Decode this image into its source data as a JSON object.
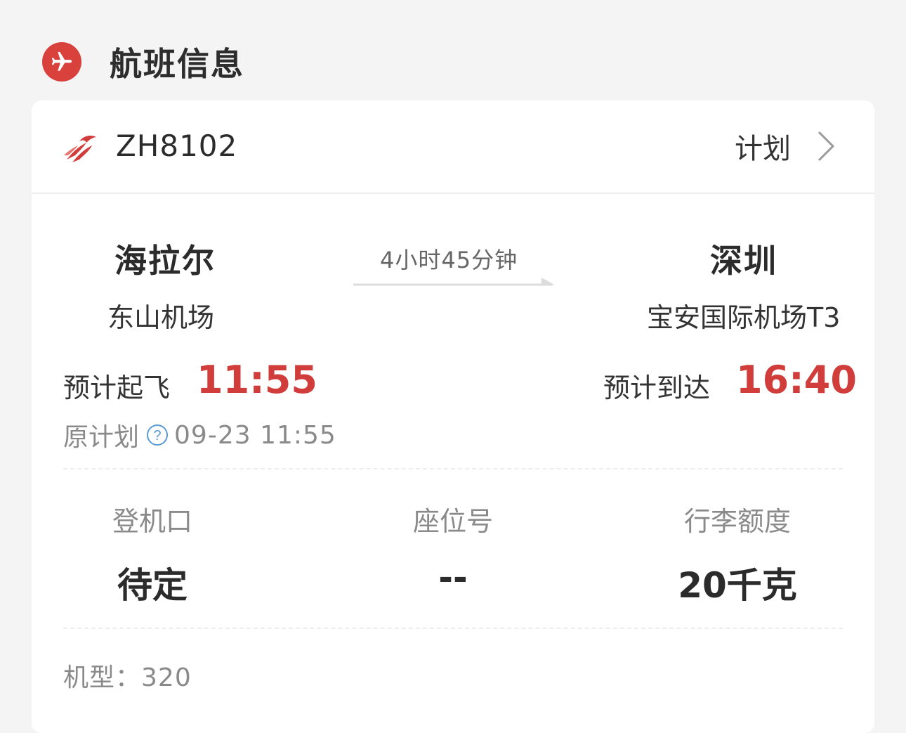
{
  "section": {
    "title": "航班信息",
    "icon": "airplane-icon"
  },
  "flight": {
    "number": "ZH8102",
    "airline_logo": "shenzhen-airlines-logo",
    "plan_label": "计划"
  },
  "route": {
    "origin_city": "海拉尔",
    "origin_airport": "东山机场",
    "destination_city": "深圳",
    "destination_airport": "宝安国际机场T3",
    "duration": "4小时45分钟"
  },
  "times": {
    "departure_label": "预计起飞",
    "departure_time": "11:55",
    "arrival_label": "预计到达",
    "arrival_time": "16:40",
    "original_label": "原计划",
    "original_time": "09-23 11:55"
  },
  "details": {
    "gate_label": "登机口",
    "gate_value": "待定",
    "seat_label": "座位号",
    "seat_value": "--",
    "baggage_label": "行李额度",
    "baggage_value": "20千克"
  },
  "aircraft": {
    "label": "机型：",
    "value": "320"
  },
  "colors": {
    "accent": "#d03d3a",
    "badge": "#d9413d"
  }
}
